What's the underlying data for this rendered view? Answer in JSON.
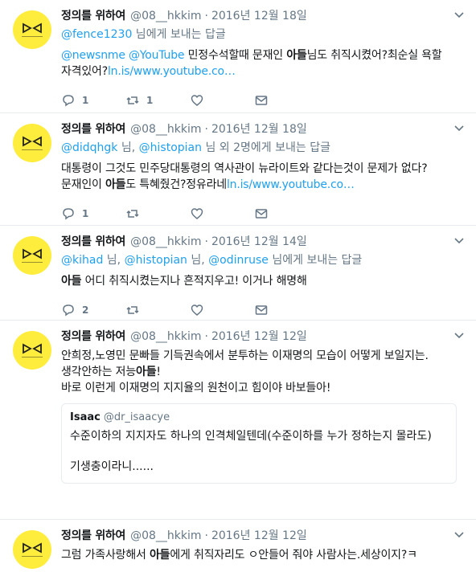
{
  "tweets": [
    {
      "name": "정의를 위하여",
      "handle": "@08__hkkim",
      "dot": "·",
      "date": "2016년 12월 18일",
      "reply_prefix": "",
      "reply_users": "@fence1230",
      "reply_suffix": " 님에게 보내는 답글",
      "line1_link": "@newsnme @YouTube",
      "line1_text": " 민정수석할때 문재인 ",
      "line1_bold": "아들",
      "line1_text2": "님도 취직시켰어?최순실 욕할",
      "line2_text": "자격있어?",
      "line2_link": "ln.is/www.youtube.co…",
      "reply_count": "1",
      "retweet_count": "1",
      "like_count": ""
    },
    {
      "name": "정의를 위하여",
      "handle": "@08__hkkim",
      "dot": "·",
      "date": "2016년 12월 18일",
      "reply_users_a": "@didqhgk",
      "reply_mid_a": " 님, ",
      "reply_users_b": "@histopian",
      "reply_suffix": " 님 외 2명에게 보내는 답글",
      "line1_text": "대통령이 그것도 민주당대통령의 역사관이 뉴라이트와 같다는것이 문제가 없다?",
      "line2_text": "문재인이 ",
      "line2_bold": "아들",
      "line2_text2": "도 특혜줬건?정유라네",
      "line2_link": "ln.is/www.youtube.co…",
      "reply_count": "1",
      "retweet_count": "",
      "like_count": ""
    },
    {
      "name": "정의를 위하여",
      "handle": "@08__hkkim",
      "dot": "·",
      "date": "2016년 12월 14일",
      "reply_users_a": "@kihad",
      "reply_mid_a": " 님, ",
      "reply_users_b": "@histopian",
      "reply_mid_b": " 님, ",
      "reply_users_c": "@odinruse",
      "reply_suffix": " 님에게 보내는 답글",
      "line1_bold": "아들",
      "line1_text": " 어디 취직시켰는지나 흔적지우고! 이거나 해명해",
      "reply_count": "2",
      "retweet_count": "",
      "like_count": ""
    },
    {
      "name": "정의를 위하여",
      "handle": "@08__hkkim",
      "dot": "·",
      "date": "2016년 12월 12일",
      "line1_text": "안희정,노영민 문빠들 기득권속에서 분투하는 이재명의 모습이 어떻게 보일지는.",
      "line2_text": "생각안하는 저능",
      "line2_bold": "아들",
      "line2_text2": "!",
      "line3_text": "바로 이런게 이재명의 지지율의 원천이고 힘이야 바보들아!",
      "quote_name": "Isaac",
      "quote_handle": "@dr_isaacye",
      "quote_line1": "수준이하의 지지자도 하나의 인격체일텐데(수준이하를 누가 정하는지 몰라도)",
      "quote_line2": "기생충이라니......"
    },
    {
      "name": "정의를 위하여",
      "handle": "@08__hkkim",
      "dot": "·",
      "date": "2016년 12월 12일",
      "line1_text": "그럼 가족사랑해서 ",
      "line1_bold": "아들",
      "line1_text2": "에게 취직자리도 ㅇ안들어 줘야 사람사는.세상이지?ㅋ"
    }
  ],
  "colors": {
    "link": "#1da1f2",
    "muted": "#657786",
    "avatar_bg": "#ffed3d"
  },
  "icons": [
    "reply-icon",
    "retweet-icon",
    "like-icon",
    "dm-icon",
    "chevron-down-icon"
  ]
}
